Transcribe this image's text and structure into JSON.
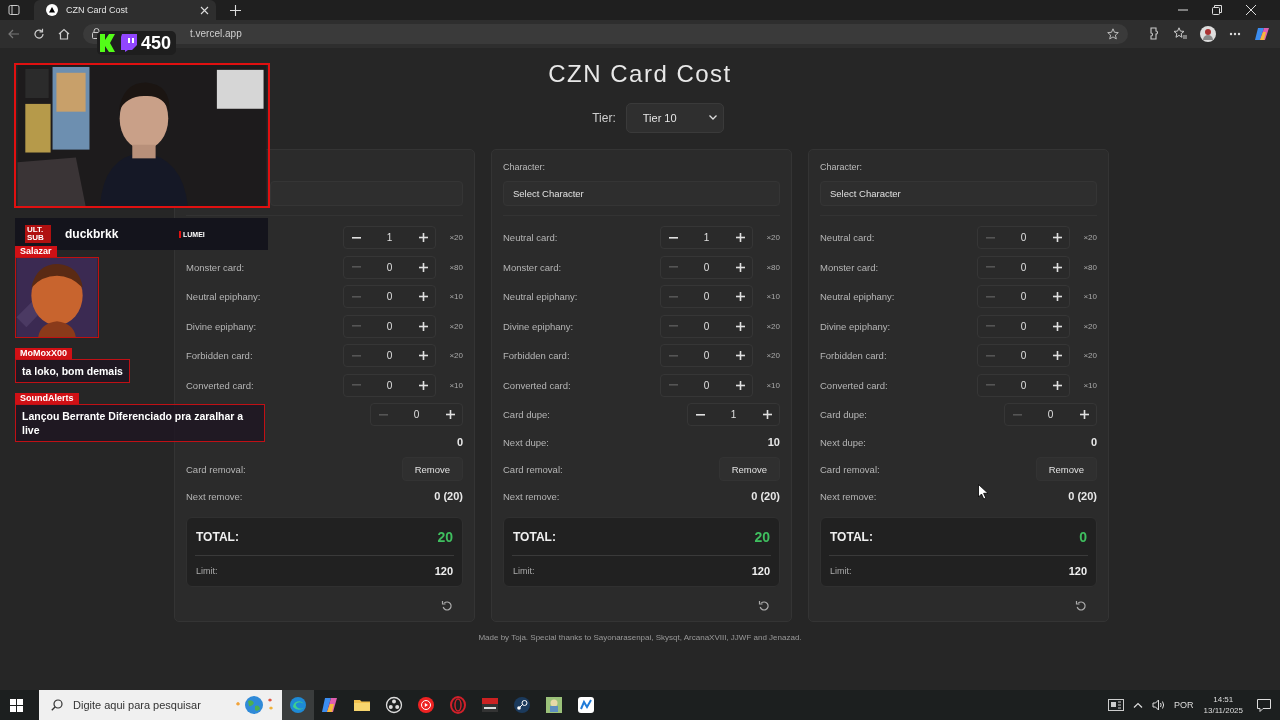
{
  "browser": {
    "tab_title": "CZN Card Cost",
    "url": "t.vercel.app"
  },
  "page": {
    "title": "CZN Card Cost",
    "tier_label": "Tier:",
    "tier_value": "Tier 10",
    "footer": "Made by Toja. Special thanks to Sayonarasenpai, Skysqt, ArcanaXVIII, JJWF and Jenazad."
  },
  "cards": [
    {
      "rows": [
        {
          "value": "1",
          "multiplier": "×20",
          "disabled": false
        },
        {
          "label": "Monster card:",
          "value": "0",
          "multiplier": "×80",
          "disabled": true
        },
        {
          "label": "Neutral epiphany:",
          "value": "0",
          "multiplier": "×10",
          "disabled": true
        },
        {
          "label": "Divine epiphany:",
          "value": "0",
          "multiplier": "×20",
          "disabled": true
        },
        {
          "label": "Forbidden card:",
          "value": "0",
          "multiplier": "×20",
          "disabled": true
        },
        {
          "label": "Converted card:",
          "value": "0",
          "multiplier": "×10",
          "disabled": true
        }
      ],
      "dupe": {
        "value": "0",
        "disabled": true
      },
      "next_dupe": {
        "value": "0"
      },
      "removal": {
        "label": "Card removal:",
        "button": "Remove"
      },
      "next_remove": {
        "label": "Next remove:",
        "value": "0 (20)"
      },
      "total": {
        "label": "TOTAL:",
        "value": "20"
      },
      "limit": {
        "label": "Limit:",
        "value": "120"
      }
    },
    {
      "character_label": "Character:",
      "select": "Select Character",
      "rows": [
        {
          "label": "Neutral card:",
          "value": "1",
          "multiplier": "×20",
          "disabled": false
        },
        {
          "label": "Monster card:",
          "value": "0",
          "multiplier": "×80",
          "disabled": true
        },
        {
          "label": "Neutral epiphany:",
          "value": "0",
          "multiplier": "×10",
          "disabled": true
        },
        {
          "label": "Divine epiphany:",
          "value": "0",
          "multiplier": "×20",
          "disabled": true
        },
        {
          "label": "Forbidden card:",
          "value": "0",
          "multiplier": "×20",
          "disabled": true
        },
        {
          "label": "Converted card:",
          "value": "0",
          "multiplier": "×10",
          "disabled": true
        }
      ],
      "dupe": {
        "label": "Card dupe:",
        "value": "1",
        "disabled": false
      },
      "next_dupe": {
        "label": "Next dupe:",
        "value": "10"
      },
      "removal": {
        "label": "Card removal:",
        "button": "Remove"
      },
      "next_remove": {
        "label": "Next remove:",
        "value": "0 (20)"
      },
      "total": {
        "label": "TOTAL:",
        "value": "20"
      },
      "limit": {
        "label": "Limit:",
        "value": "120"
      }
    },
    {
      "character_label": "Character:",
      "select": "Select Character",
      "rows": [
        {
          "label": "Neutral card:",
          "value": "0",
          "multiplier": "×20",
          "disabled": true
        },
        {
          "label": "Monster card:",
          "value": "0",
          "multiplier": "×80",
          "disabled": true
        },
        {
          "label": "Neutral epiphany:",
          "value": "0",
          "multiplier": "×10",
          "disabled": true
        },
        {
          "label": "Divine epiphany:",
          "value": "0",
          "multiplier": "×20",
          "disabled": true
        },
        {
          "label": "Forbidden card:",
          "value": "0",
          "multiplier": "×20",
          "disabled": true
        },
        {
          "label": "Converted card:",
          "value": "0",
          "multiplier": "×10",
          "disabled": true
        }
      ],
      "dupe": {
        "label": "Card dupe:",
        "value": "0",
        "disabled": true
      },
      "next_dupe": {
        "label": "Next dupe:",
        "value": "0"
      },
      "removal": {
        "label": "Card removal:",
        "button": "Remove"
      },
      "next_remove": {
        "label": "Next remove:",
        "value": "0 (20)"
      },
      "total": {
        "label": "TOTAL:",
        "value": "0"
      },
      "limit": {
        "label": "Limit:",
        "value": "120"
      }
    }
  ],
  "overlay": {
    "viewer_count": "450",
    "sub_badge": "ULT. SUB",
    "subscriber": "duckbrkk",
    "brand": "LUMEI",
    "chat": [
      {
        "user": "Salazar",
        "kind": "picture"
      },
      {
        "user": "MoMoxX00",
        "kind": "text",
        "message": "ta loko, bom demais"
      },
      {
        "user": "SoundAlerts",
        "kind": "text",
        "message": "Lançou Berrante Diferenciado pra zaralhar a live"
      }
    ]
  },
  "taskbar": {
    "search": {
      "placeholder": "Digite aqui para pesquisar"
    },
    "language": "POR",
    "time": "14:51",
    "date": "13/11/2025"
  }
}
